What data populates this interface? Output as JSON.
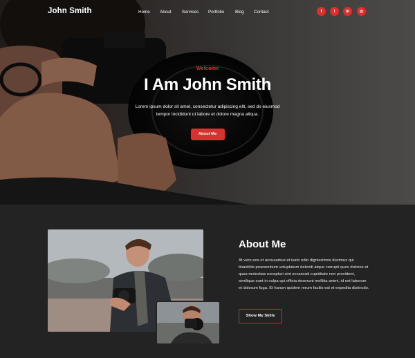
{
  "header": {
    "logo": "John Smith",
    "nav": [
      "Home",
      "About",
      "Services",
      "Portfolio",
      "Blog",
      "Contact"
    ],
    "social": [
      {
        "icon": "facebook-icon",
        "glyph": "f"
      },
      {
        "icon": "twitter-icon",
        "glyph": "t"
      },
      {
        "icon": "linkedin-icon",
        "glyph": "in"
      },
      {
        "icon": "instagram-icon",
        "glyph": "◎"
      }
    ]
  },
  "hero": {
    "eyebrow": "Welcome",
    "title": "I Am John Smith",
    "description_line1": "Lorem ipsum dolor sit amet, consectetur adipiscing elit, sed do eiusmod",
    "description_line2": "tempor incididunt ut labore et dolore magna aliqua.",
    "button": "About Me"
  },
  "about": {
    "title": "About Me",
    "text": "At vero eos et accusamus et iusto odio dignissimos ducimus qui blanditiis praesentium voluptatum deleniti atque corrupti quos dolores et quas molestias excepturi sint occaecati cupiditate non provident, similique sunt in culpa qui officia deserunt mollitia animi, id est laborum et dolorum fuga. Et harum quidem rerum facilis est et expedita distinctio.",
    "button": "Show My Skills"
  },
  "colors": {
    "accent": "#dd2e2e",
    "background_dark": "#232323"
  }
}
